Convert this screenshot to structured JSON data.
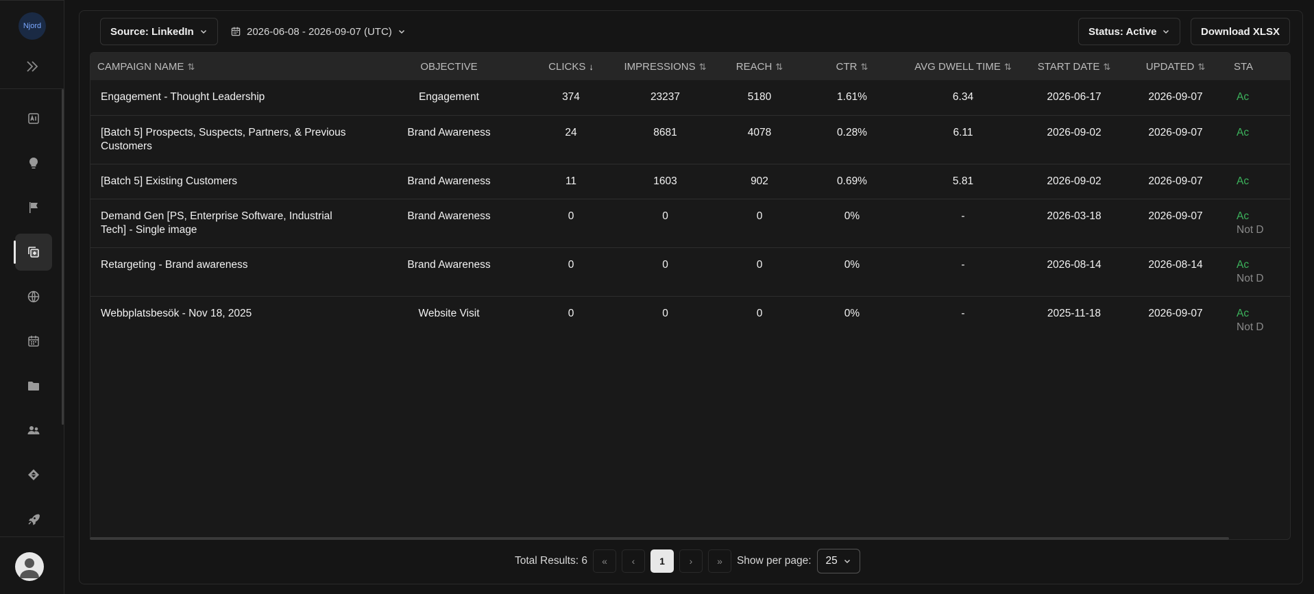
{
  "brand": {
    "logo_text": "Njord"
  },
  "sidebar": {
    "items": [
      {
        "name": "ai-report-icon"
      },
      {
        "name": "lightbulb-icon"
      },
      {
        "name": "flag-icon"
      },
      {
        "name": "campaigns-icon",
        "active": true
      },
      {
        "name": "globe-icon"
      },
      {
        "name": "calendar-icon"
      },
      {
        "name": "folder-icon"
      },
      {
        "name": "users-icon"
      },
      {
        "name": "tag-icon"
      },
      {
        "name": "rocket-icon"
      }
    ]
  },
  "toolbar": {
    "source_label": "Source: LinkedIn",
    "date_range": "2026-06-08 - 2026-09-07 (UTC)",
    "status_label": "Status: Active",
    "download_label": "Download XLSX"
  },
  "table": {
    "columns": [
      "CAMPAIGN NAME",
      "OBJECTIVE",
      "CLICKS",
      "IMPRESSIONS",
      "REACH",
      "CTR",
      "AVG DWELL TIME",
      "START DATE",
      "UPDATED",
      "STA"
    ],
    "rows": [
      {
        "name": "Engagement - Thought Leadership",
        "objective": "Engagement",
        "clicks": "374",
        "impressions": "23237",
        "reach": "5180",
        "ctr": "1.61%",
        "dwell": "6.34",
        "start": "2026-06-17",
        "updated": "2026-09-07",
        "status": "Ac",
        "status_sub": ""
      },
      {
        "name": "[Batch 5] Prospects, Suspects, Partners, & Previous Customers",
        "objective": "Brand Awareness",
        "clicks": "24",
        "impressions": "8681",
        "reach": "4078",
        "ctr": "0.28%",
        "dwell": "6.11",
        "start": "2026-09-02",
        "updated": "2026-09-07",
        "status": "Ac",
        "status_sub": ""
      },
      {
        "name": "[Batch 5] Existing Customers",
        "objective": "Brand Awareness",
        "clicks": "11",
        "impressions": "1603",
        "reach": "902",
        "ctr": "0.69%",
        "dwell": "5.81",
        "start": "2026-09-02",
        "updated": "2026-09-07",
        "status": "Ac",
        "status_sub": ""
      },
      {
        "name": "Demand Gen [PS, Enterprise Software, Industrial Tech] - Single image",
        "objective": "Brand Awareness",
        "clicks": "0",
        "impressions": "0",
        "reach": "0",
        "ctr": "0%",
        "dwell": "-",
        "start": "2026-03-18",
        "updated": "2026-09-07",
        "status": "Ac",
        "status_sub": "Not D"
      },
      {
        "name": "Retargeting - Brand awareness",
        "objective": "Brand Awareness",
        "clicks": "0",
        "impressions": "0",
        "reach": "0",
        "ctr": "0%",
        "dwell": "-",
        "start": "2026-08-14",
        "updated": "2026-08-14",
        "status": "Ac",
        "status_sub": "Not D"
      },
      {
        "name": "Webbplatsbesök - Nov 18, 2025",
        "objective": "Website Visit",
        "clicks": "0",
        "impressions": "0",
        "reach": "0",
        "ctr": "0%",
        "dwell": "-",
        "start": "2025-11-18",
        "updated": "2026-09-07",
        "status": "Ac",
        "status_sub": "Not D"
      }
    ]
  },
  "pagination": {
    "total_label": "Total Results: 6",
    "current_page": "1",
    "per_page_label": "Show per page:",
    "per_page_value": "25"
  },
  "colors": {
    "status_active": "#3cb35c",
    "background": "#141414"
  }
}
